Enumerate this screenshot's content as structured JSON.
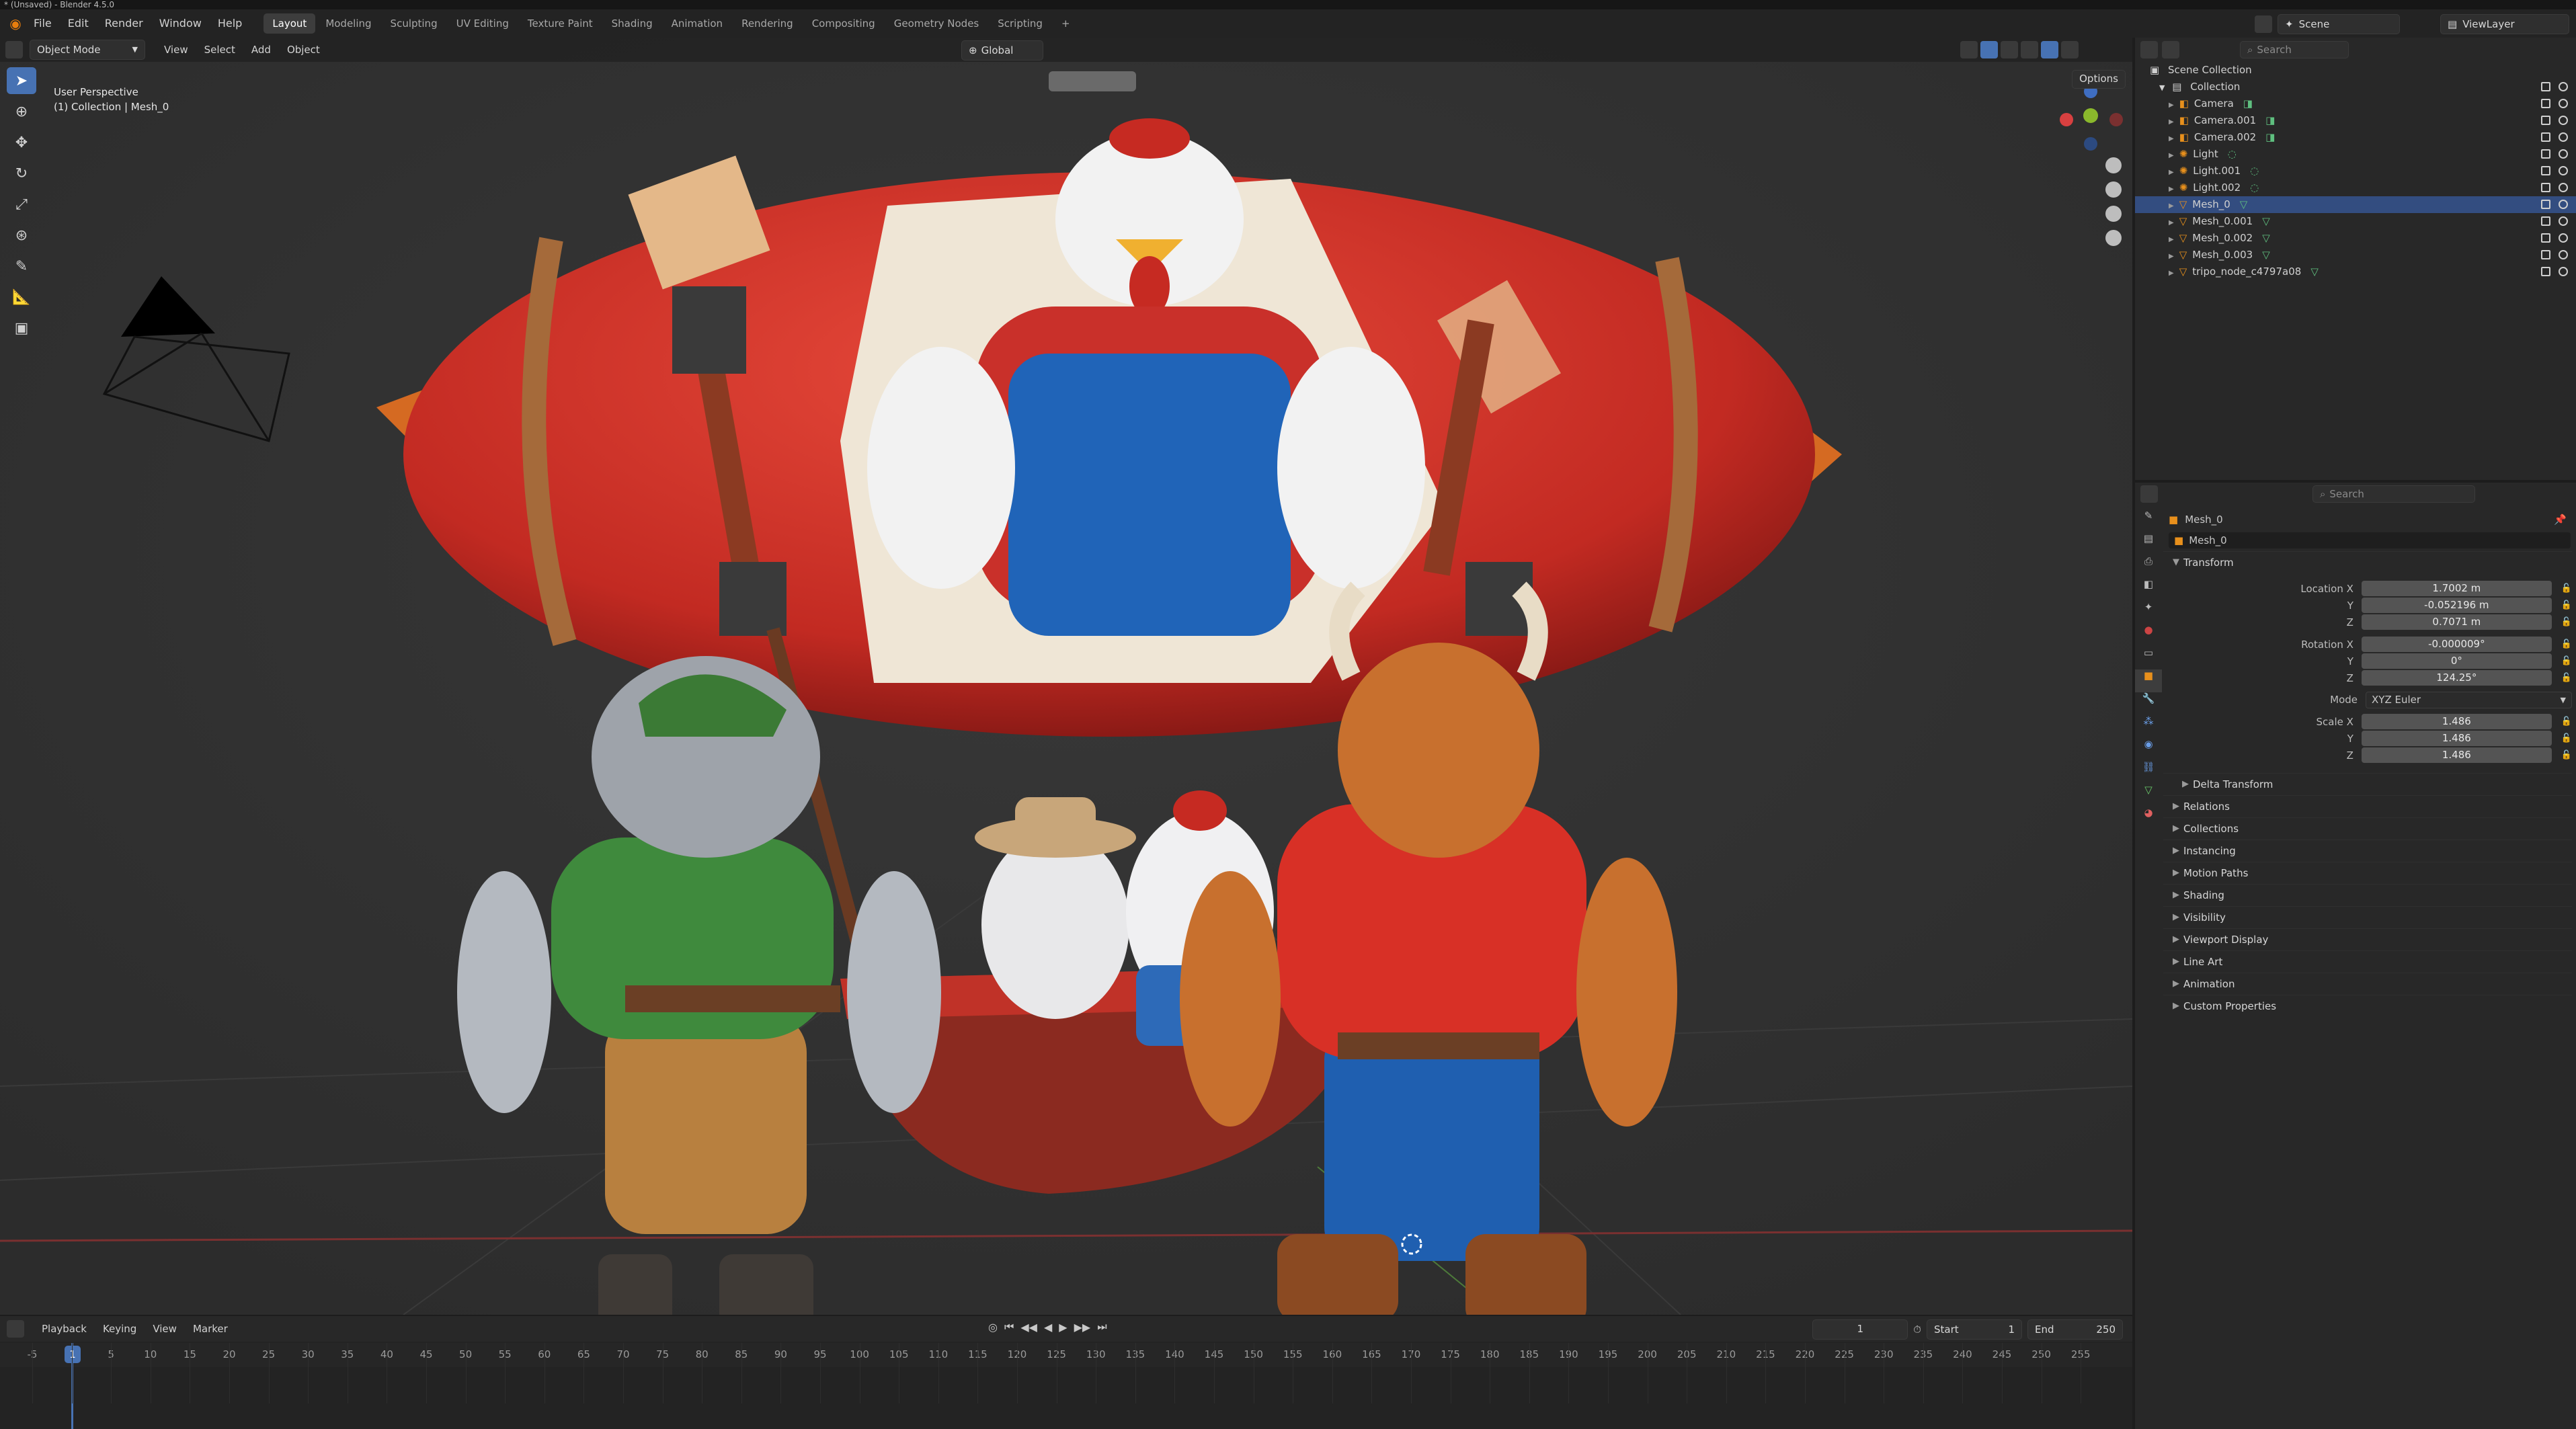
{
  "window": {
    "title": "* (Unsaved) - Blender 4.5.0"
  },
  "menu": {
    "items": [
      "File",
      "Edit",
      "Render",
      "Window",
      "Help"
    ]
  },
  "workspaces": {
    "active": "Layout",
    "tabs": [
      "Layout",
      "Modeling",
      "Sculpting",
      "UV Editing",
      "Texture Paint",
      "Shading",
      "Animation",
      "Rendering",
      "Compositing",
      "Geometry Nodes",
      "Scripting",
      "+"
    ]
  },
  "topright": {
    "scene": "Scene",
    "view_layer": "ViewLayer"
  },
  "viewport_header": {
    "mode": "Object Mode",
    "menus": [
      "View",
      "Select",
      "Add",
      "Object"
    ],
    "transform_orientation": "Global",
    "options": "Options"
  },
  "viewport_info": {
    "line1": "User Perspective",
    "line2": "(1) Collection | Mesh_0"
  },
  "timeline": {
    "menus": [
      "Playback",
      "Keying",
      "View",
      "Marker"
    ],
    "current_frame": "1",
    "start_label": "Start",
    "start": "1",
    "end_label": "End",
    "end": "250",
    "ticks": [
      "-5",
      "1",
      "5",
      "10",
      "15",
      "20",
      "25",
      "30",
      "35",
      "40",
      "45",
      "50",
      "55",
      "60",
      "65",
      "70",
      "75",
      "80",
      "85",
      "90",
      "95",
      "100",
      "105",
      "110",
      "115",
      "120",
      "125",
      "130",
      "135",
      "140",
      "145",
      "150",
      "155",
      "160",
      "165",
      "170",
      "175",
      "180",
      "185",
      "190",
      "195",
      "200",
      "205",
      "210",
      "215",
      "220",
      "225",
      "230",
      "235",
      "240",
      "245",
      "250",
      "255"
    ]
  },
  "outliner": {
    "search_placeholder": "Search",
    "root": "Scene Collection",
    "collection": "Collection",
    "items": [
      "Camera",
      "Camera.001",
      "Camera.002",
      "Light",
      "Light.001",
      "Light.002",
      "Mesh_0",
      "Mesh_0.001",
      "Mesh_0.002",
      "Mesh_0.003",
      "tripo_node_c4797a08"
    ]
  },
  "properties": {
    "search_placeholder": "Search",
    "object_name": "Mesh_0",
    "data_name": "Mesh_0",
    "transform_label": "Transform",
    "location_label": "Location X",
    "location": [
      "1.7002 m",
      "-0.052196 m",
      "0.7071 m"
    ],
    "rotation_label": "Rotation X",
    "rotation": [
      "-0.000009°",
      "0°",
      "124.25°"
    ],
    "mode_label": "Mode",
    "mode": "XYZ Euler",
    "scale_label": "Scale X",
    "scale": [
      "1.486",
      "1.486",
      "1.486"
    ],
    "y_label": "Y",
    "z_label": "Z",
    "delta_transform": "Delta Transform",
    "panels": [
      "Relations",
      "Collections",
      "Instancing",
      "Motion Paths",
      "Shading",
      "Visibility",
      "Viewport Display",
      "Line Art",
      "Animation",
      "Custom Properties"
    ]
  },
  "colors": {
    "accent": "#4772b3",
    "selection": "#334d80",
    "blimp_red": "#d2332a",
    "background": "#2f2f2f"
  }
}
